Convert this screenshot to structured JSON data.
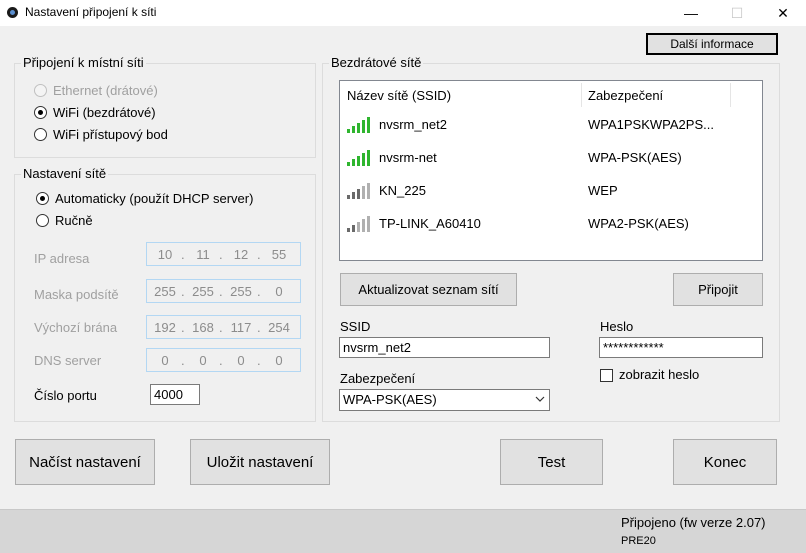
{
  "window": {
    "title": "Nastavení připojení k síti",
    "controls": {
      "minimize": "—",
      "maximize": "☐",
      "close": "✕"
    },
    "icon": "app-icon"
  },
  "more_info_button": "Další informace",
  "local_connection": {
    "legend": "Připojení k místní síti",
    "options": [
      {
        "label": "Ethernet (drátové)",
        "checked": false,
        "enabled": false
      },
      {
        "label": "WiFi (bezdrátové)",
        "checked": true,
        "enabled": true
      },
      {
        "label": "WiFi přístupový bod",
        "checked": false,
        "enabled": true
      }
    ]
  },
  "network_settings": {
    "legend": "Nastavení sítě",
    "options": [
      {
        "label": "Automaticky (použít DHCP server)",
        "checked": true
      },
      {
        "label": "Ručně",
        "checked": false
      }
    ],
    "fields": [
      {
        "label": "IP adresa",
        "value": [
          "10",
          "11",
          "12",
          "55"
        ]
      },
      {
        "label": "Maska podsítě",
        "value": [
          "255",
          "255",
          "255",
          "0"
        ]
      },
      {
        "label": "Výchozí brána",
        "value": [
          "192",
          "168",
          "117",
          "254"
        ]
      },
      {
        "label": "DNS server",
        "value": [
          "0",
          "0",
          "0",
          "0"
        ]
      }
    ],
    "port_label": "Číslo portu",
    "port_value": "4000"
  },
  "wireless": {
    "legend": "Bezdrátové sítě",
    "columns": [
      "Název sítě (SSID)",
      "Zabezpečení"
    ],
    "networks": [
      {
        "ssid": "nvsrm_net2",
        "security": "WPA1PSKWPA2PS...",
        "signal": 4
      },
      {
        "ssid": "nvsrm-net",
        "security": "WPA-PSK(AES)",
        "signal": 4
      },
      {
        "ssid": "KN_225",
        "security": "WEP",
        "signal": 2
      },
      {
        "ssid": "TP-LINK_A60410",
        "security": "WPA2-PSK(AES)",
        "signal": 1
      }
    ],
    "refresh_button": "Aktualizovat seznam sítí",
    "connect_button": "Připojit",
    "ssid_label": "SSID",
    "ssid_value": "nvsrm_net2",
    "password_label": "Heslo",
    "password_value": "************",
    "security_label": "Zabezpečení",
    "security_value": "WPA-PSK(AES)",
    "show_password_label": "zobrazit heslo",
    "show_password_checked": false,
    "colors": {
      "signal_on": "#2fb52f",
      "signal_off": "#8a8a8a"
    }
  },
  "bottom_buttons": {
    "load": "Načíst nastavení",
    "save": "Uložit nastavení",
    "test": "Test",
    "close": "Konec"
  },
  "status": {
    "line1": "Připojeno (fw verze 2.07)",
    "line2": "PRE20"
  }
}
